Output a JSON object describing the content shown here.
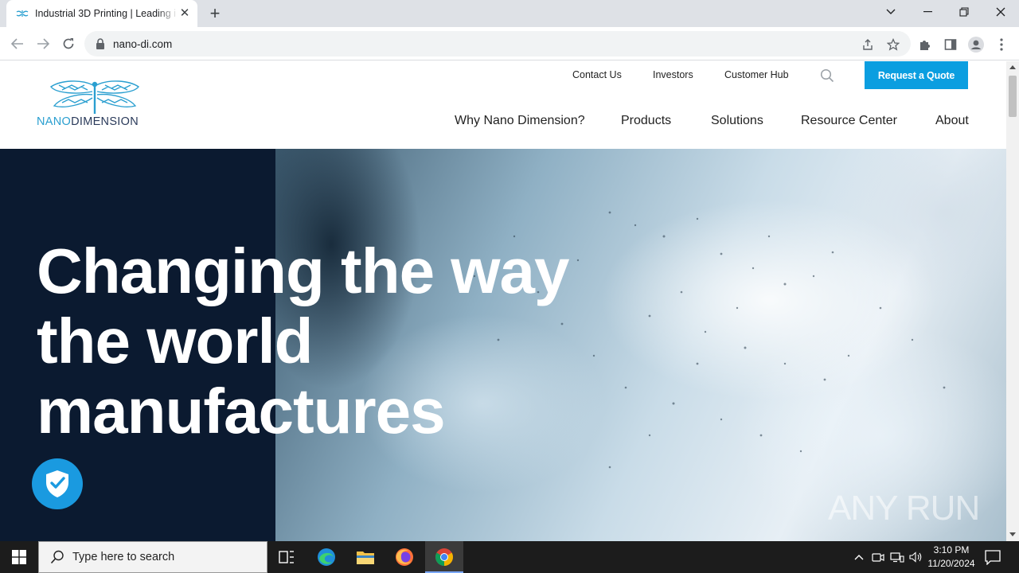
{
  "browser": {
    "tab": {
      "title": "Industrial 3D Printing | Leading i"
    },
    "url": "nano-di.com"
  },
  "site": {
    "logo": {
      "part1": "NANO",
      "part2": "DIMENSION"
    },
    "utility_nav": [
      "Contact Us",
      "Investors",
      "Customer Hub"
    ],
    "cta_label": "Request a Quote",
    "main_nav": [
      "Why Nano Dimension?",
      "Products",
      "Solutions",
      "Resource Center",
      "About"
    ],
    "hero": {
      "lines": [
        "Changing the way",
        "the world",
        "manufactures"
      ]
    },
    "watermark": "ANY RUN"
  },
  "taskbar": {
    "search_placeholder": "Type here to search",
    "time": "3:10 PM",
    "date": "11/20/2024"
  },
  "colors": {
    "accent": "#0b9ee0",
    "hero_panel": "#0b1a30",
    "taskbar": "#1c1c1c"
  }
}
